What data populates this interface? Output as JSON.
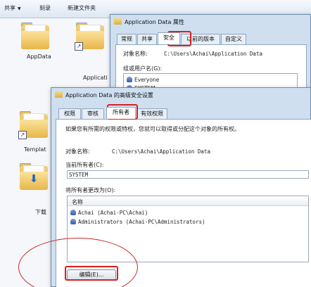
{
  "toolbar": {
    "share_label": "共享",
    "burn_label": "刻录",
    "new_folder_label": "新建文件夹"
  },
  "files": [
    {
      "label": "AppData"
    },
    {
      "label": "Applicati"
    },
    {
      "label": "Templat"
    },
    {
      "label": "下载"
    }
  ],
  "properties_dialog": {
    "title": "Application Data 属性",
    "tabs": [
      "常规",
      "共享",
      "安全",
      "以前的版本",
      "自定义"
    ],
    "active_tab_index": 2,
    "object_name_label": "对象名称:",
    "object_name_value": "C:\\Users\\Achai\\Application Data",
    "groups_label": "组或用户名(G):",
    "users": [
      "Everyone",
      "SYSTEM"
    ]
  },
  "advanced_dialog": {
    "title": "Application Data 的高级安全设置",
    "tabs": [
      "权限",
      "审核",
      "所有者",
      "有效权限"
    ],
    "active_tab_index": 2,
    "description": "如果您有所需的权限或特权，您就可以取得或分配这个对象的所有权。",
    "object_name_label": "对象名称:",
    "object_name_value": "C:\\Users\\Achai\\Application Data",
    "current_owner_label": "当前所有者(C):",
    "current_owner_value": "SYSTEM",
    "change_owner_label": "将所有者更改为(O):",
    "column_name": "名称",
    "owners": [
      "Achai (Achai-PC\\Achai)",
      "Administrators (Achai-PC\\Administrators)"
    ],
    "edit_button_label": "编辑(E)..."
  },
  "colors": {
    "annotation_red": "#d82020",
    "window_frame": "#cfdff0"
  }
}
